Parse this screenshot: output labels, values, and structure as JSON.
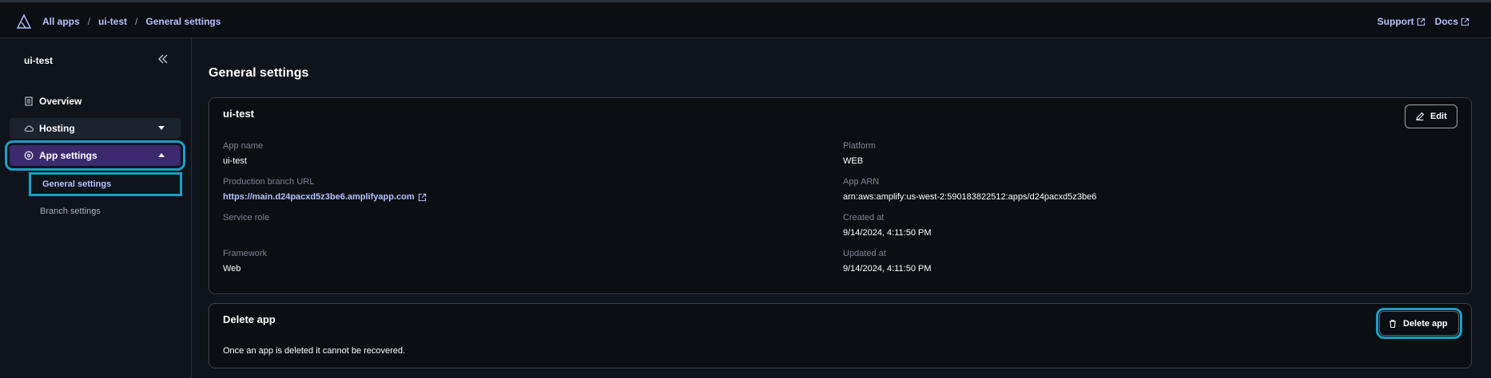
{
  "breadcrumb": [
    "All apps",
    "ui-test",
    "General settings"
  ],
  "top_links": {
    "support": "Support",
    "docs": "Docs"
  },
  "sidebar": {
    "title": "ui-test",
    "items": [
      {
        "label": "Overview"
      },
      {
        "label": "Hosting"
      },
      {
        "label": "App settings"
      }
    ],
    "sub_items": [
      {
        "label": "General settings"
      },
      {
        "label": "Branch settings"
      }
    ]
  },
  "page": {
    "title": "General settings"
  },
  "app_card": {
    "title": "ui-test",
    "edit_label": "Edit",
    "fields": {
      "app_name": {
        "label": "App name",
        "value": "ui-test"
      },
      "production_branch_url": {
        "label": "Production branch URL",
        "value": "https://main.d24pacxd5z3be6.amplifyapp.com"
      },
      "service_role": {
        "label": "Service role",
        "value": ""
      },
      "framework": {
        "label": "Framework",
        "value": "Web"
      },
      "platform": {
        "label": "Platform",
        "value": "WEB"
      },
      "app_arn": {
        "label": "App ARN",
        "value": "arn:aws:amplify:us-west-2:590183822512:apps/d24pacxd5z3be6"
      },
      "created_at": {
        "label": "Created at",
        "value": "9/14/2024, 4:11:50 PM"
      },
      "updated_at": {
        "label": "Updated at",
        "value": "9/14/2024, 4:11:50 PM"
      }
    }
  },
  "delete_card": {
    "title": "Delete app",
    "button_label": "Delete app",
    "description": "Once an app is deleted it cannot be recovered."
  },
  "colors": {
    "accent": "#b8c2ff",
    "selected_nav": "#3d2a6e",
    "highlight": "#1aa0c8"
  }
}
